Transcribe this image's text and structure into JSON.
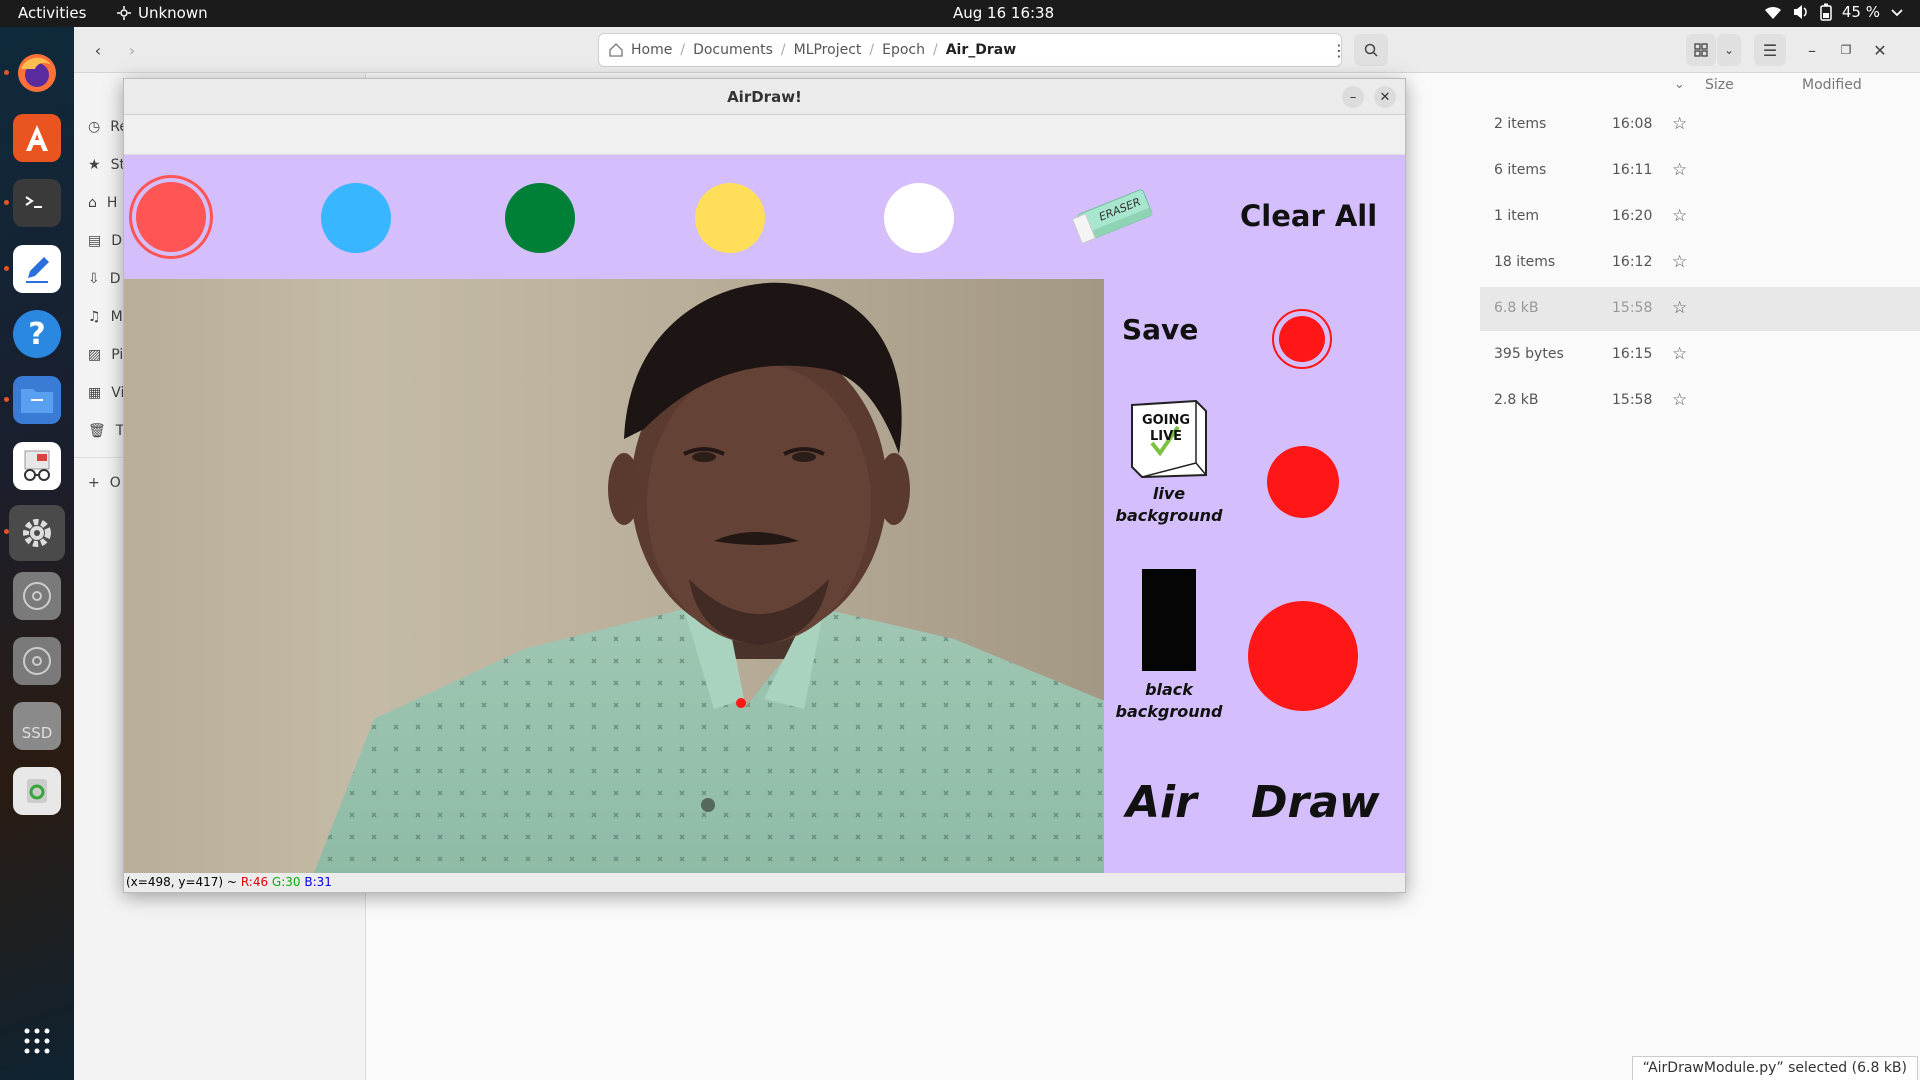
{
  "topbar": {
    "activities": "Activities",
    "app_name": "Unknown",
    "clock": "Aug 16  16:38",
    "battery": "45 %"
  },
  "dock": {
    "items": [
      {
        "name": "firefox",
        "running": true
      },
      {
        "name": "app-center",
        "running": false
      },
      {
        "name": "terminal",
        "running": true
      },
      {
        "name": "text-editor",
        "running": true
      },
      {
        "name": "help",
        "running": false
      },
      {
        "name": "files",
        "running": true
      },
      {
        "name": "document-viewer",
        "running": false
      },
      {
        "name": "settings",
        "running": true
      },
      {
        "name": "disc",
        "running": false
      },
      {
        "name": "disc",
        "running": false
      },
      {
        "name": "ssd",
        "running": false
      },
      {
        "name": "trash",
        "running": false
      }
    ],
    "ssd_label": "SSD"
  },
  "files": {
    "path": [
      "Home",
      "Documents",
      "MLProject",
      "Epoch",
      "Air_Draw"
    ],
    "sidebar": [
      {
        "label": "Re",
        "icon": "clock-icon"
      },
      {
        "label": "St",
        "icon": "star-icon"
      },
      {
        "label": "H",
        "icon": "home-icon"
      },
      {
        "label": "D",
        "icon": "document-icon"
      },
      {
        "label": "D",
        "icon": "download-icon"
      },
      {
        "label": "M",
        "icon": "music-icon"
      },
      {
        "label": "Pi",
        "icon": "picture-icon"
      },
      {
        "label": "Vi",
        "icon": "video-icon"
      },
      {
        "label": "Tr",
        "icon": "trash-icon"
      },
      {
        "label": "O",
        "icon": "plus-icon"
      }
    ],
    "columns": {
      "size": "Size",
      "modified": "Modified"
    },
    "rows": [
      {
        "size": "2 items",
        "modified": "16:08"
      },
      {
        "size": "6 items",
        "modified": "16:11"
      },
      {
        "size": "1 item",
        "modified": "16:20"
      },
      {
        "size": "18 items",
        "modified": "16:12"
      },
      {
        "size": "6.8 kB",
        "modified": "15:58"
      },
      {
        "size": "395 bytes",
        "modified": "16:15"
      },
      {
        "size": "2.8 kB",
        "modified": "15:58"
      }
    ],
    "status": "“AirDrawModule.py” selected  (6.8 kB)"
  },
  "airdraw": {
    "title": "AirDraw!",
    "palette": [
      {
        "name": "red",
        "color": "#ff5555",
        "selected": true
      },
      {
        "name": "blue",
        "color": "#38b6ff",
        "selected": false
      },
      {
        "name": "green",
        "color": "#008037",
        "selected": false
      },
      {
        "name": "yellow",
        "color": "#ffde59",
        "selected": false
      },
      {
        "name": "white",
        "color": "#ffffff",
        "selected": false
      }
    ],
    "eraser_text": "ERASER",
    "clear_all": "Clear All",
    "save": "Save",
    "brush_color": "#ff1616",
    "live_bg_sign": "GOING LIVE",
    "live_bg_label_1": "live",
    "live_bg_label_2": "background",
    "black_bg_label_1": "black",
    "black_bg_label_2": "background",
    "word_air": "Air",
    "word_draw": "Draw",
    "status_coords": "(x=498, y=417) ~",
    "status_r": "R:46",
    "status_g": "G:30",
    "status_b": "B:31",
    "status_r_color": "#e00000",
    "status_g_color": "#00b000",
    "status_b_color": "#0000e0"
  }
}
